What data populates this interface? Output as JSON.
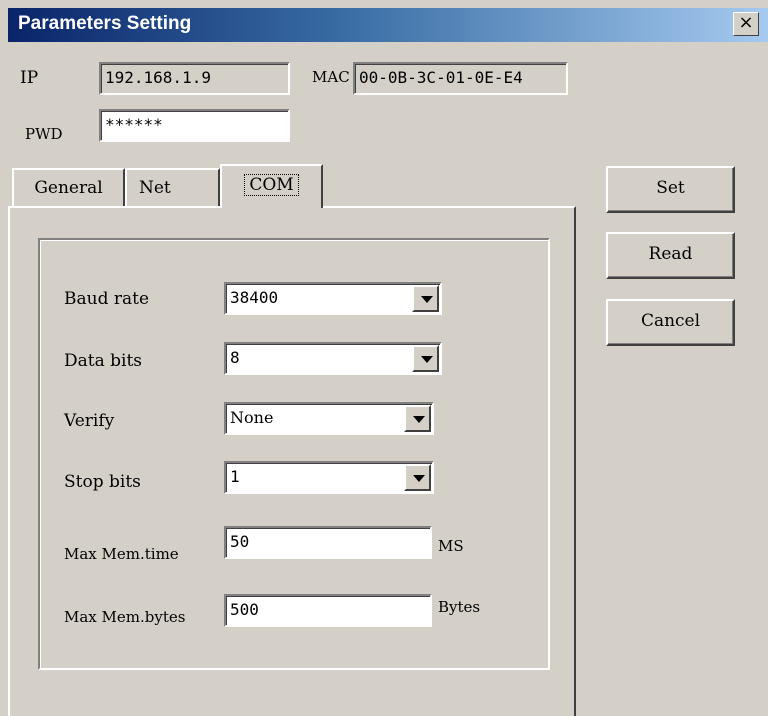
{
  "window": {
    "title": "Parameters Setting",
    "close_label": "×"
  },
  "header": {
    "ip_label": "IP",
    "ip_value": "192.168.1.9",
    "mac_label": "MAC",
    "mac_value": "00-0B-3C-01-0E-E4",
    "pwd_label": "PWD",
    "pwd_value": "******"
  },
  "tabs": [
    {
      "label": "General"
    },
    {
      "label": "Net"
    },
    {
      "label": "COM",
      "active": true
    }
  ],
  "com": {
    "baud_rate_label": "Baud rate",
    "baud_rate_value": "38400",
    "data_bits_label": "Data bits",
    "data_bits_value": "8",
    "verify_label": "Verify",
    "verify_value": "None",
    "stop_bits_label": "Stop bits",
    "stop_bits_value": "1",
    "max_mem_time_label": "Max Mem.time",
    "max_mem_time_value": "50",
    "max_mem_time_unit": "MS",
    "max_mem_bytes_label": "Max Mem.bytes",
    "max_mem_bytes_value": "500",
    "max_mem_bytes_unit": "Bytes"
  },
  "buttons": {
    "set": "Set",
    "read": "Read",
    "cancel": "Cancel"
  }
}
